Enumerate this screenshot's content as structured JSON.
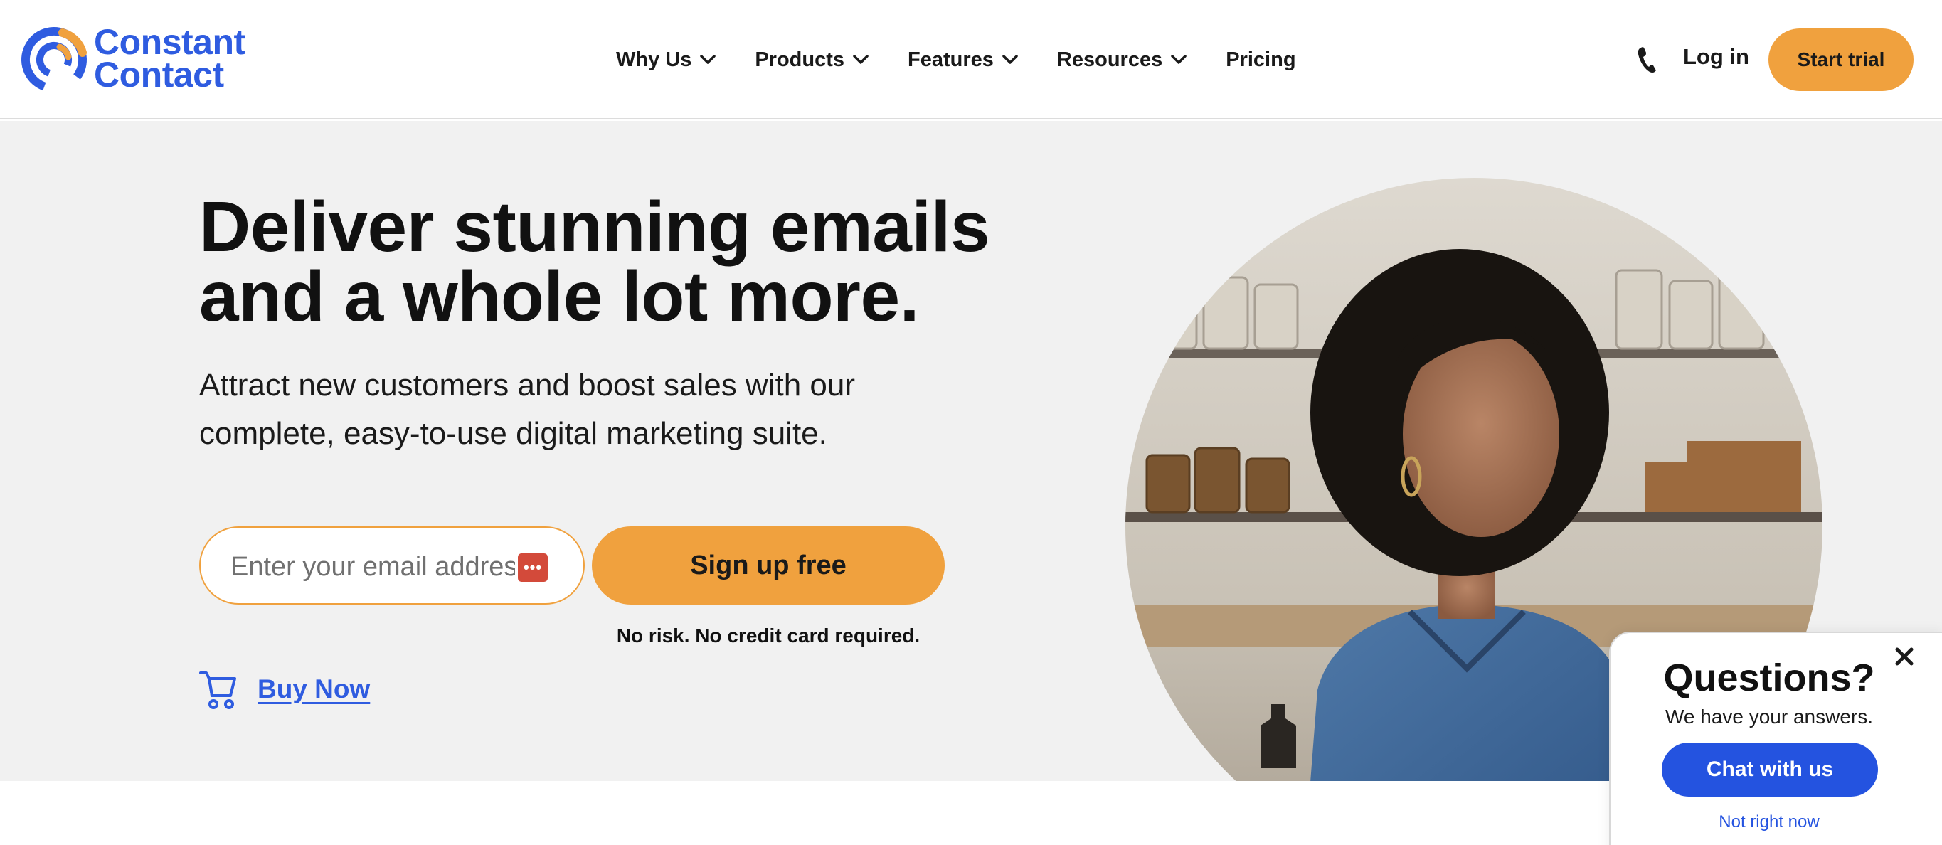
{
  "brand": {
    "name_line1": "Constant",
    "name_line2": "Contact",
    "primary_color": "#2f5ce0",
    "accent_color": "#f0a13e"
  },
  "nav": {
    "items": [
      {
        "label": "Why Us",
        "has_dropdown": true
      },
      {
        "label": "Products",
        "has_dropdown": true
      },
      {
        "label": "Features",
        "has_dropdown": true
      },
      {
        "label": "Resources",
        "has_dropdown": true
      },
      {
        "label": "Pricing",
        "has_dropdown": false
      }
    ],
    "login_label": "Log in",
    "trial_label": "Start trial",
    "phone_icon": "phone-icon"
  },
  "hero": {
    "headline_line1": "Deliver stunning emails",
    "headline_line2": "and a whole lot more.",
    "subhead_line1": "Attract new customers and boost sales with our",
    "subhead_line2": "complete, easy-to-use digital marketing suite.",
    "email_placeholder": "Enter your email address",
    "signup_label": "Sign up free",
    "disclaimer": "No risk. No credit card required.",
    "buy_now_label": "Buy Now",
    "cart_icon": "shopping-cart-icon",
    "background_color": "#f1f1f1"
  },
  "chat_widget": {
    "title": "Questions?",
    "subtitle": "We have your answers.",
    "chat_button_label": "Chat with us",
    "dismiss_label": "Not right now",
    "button_color": "#2453e0"
  }
}
